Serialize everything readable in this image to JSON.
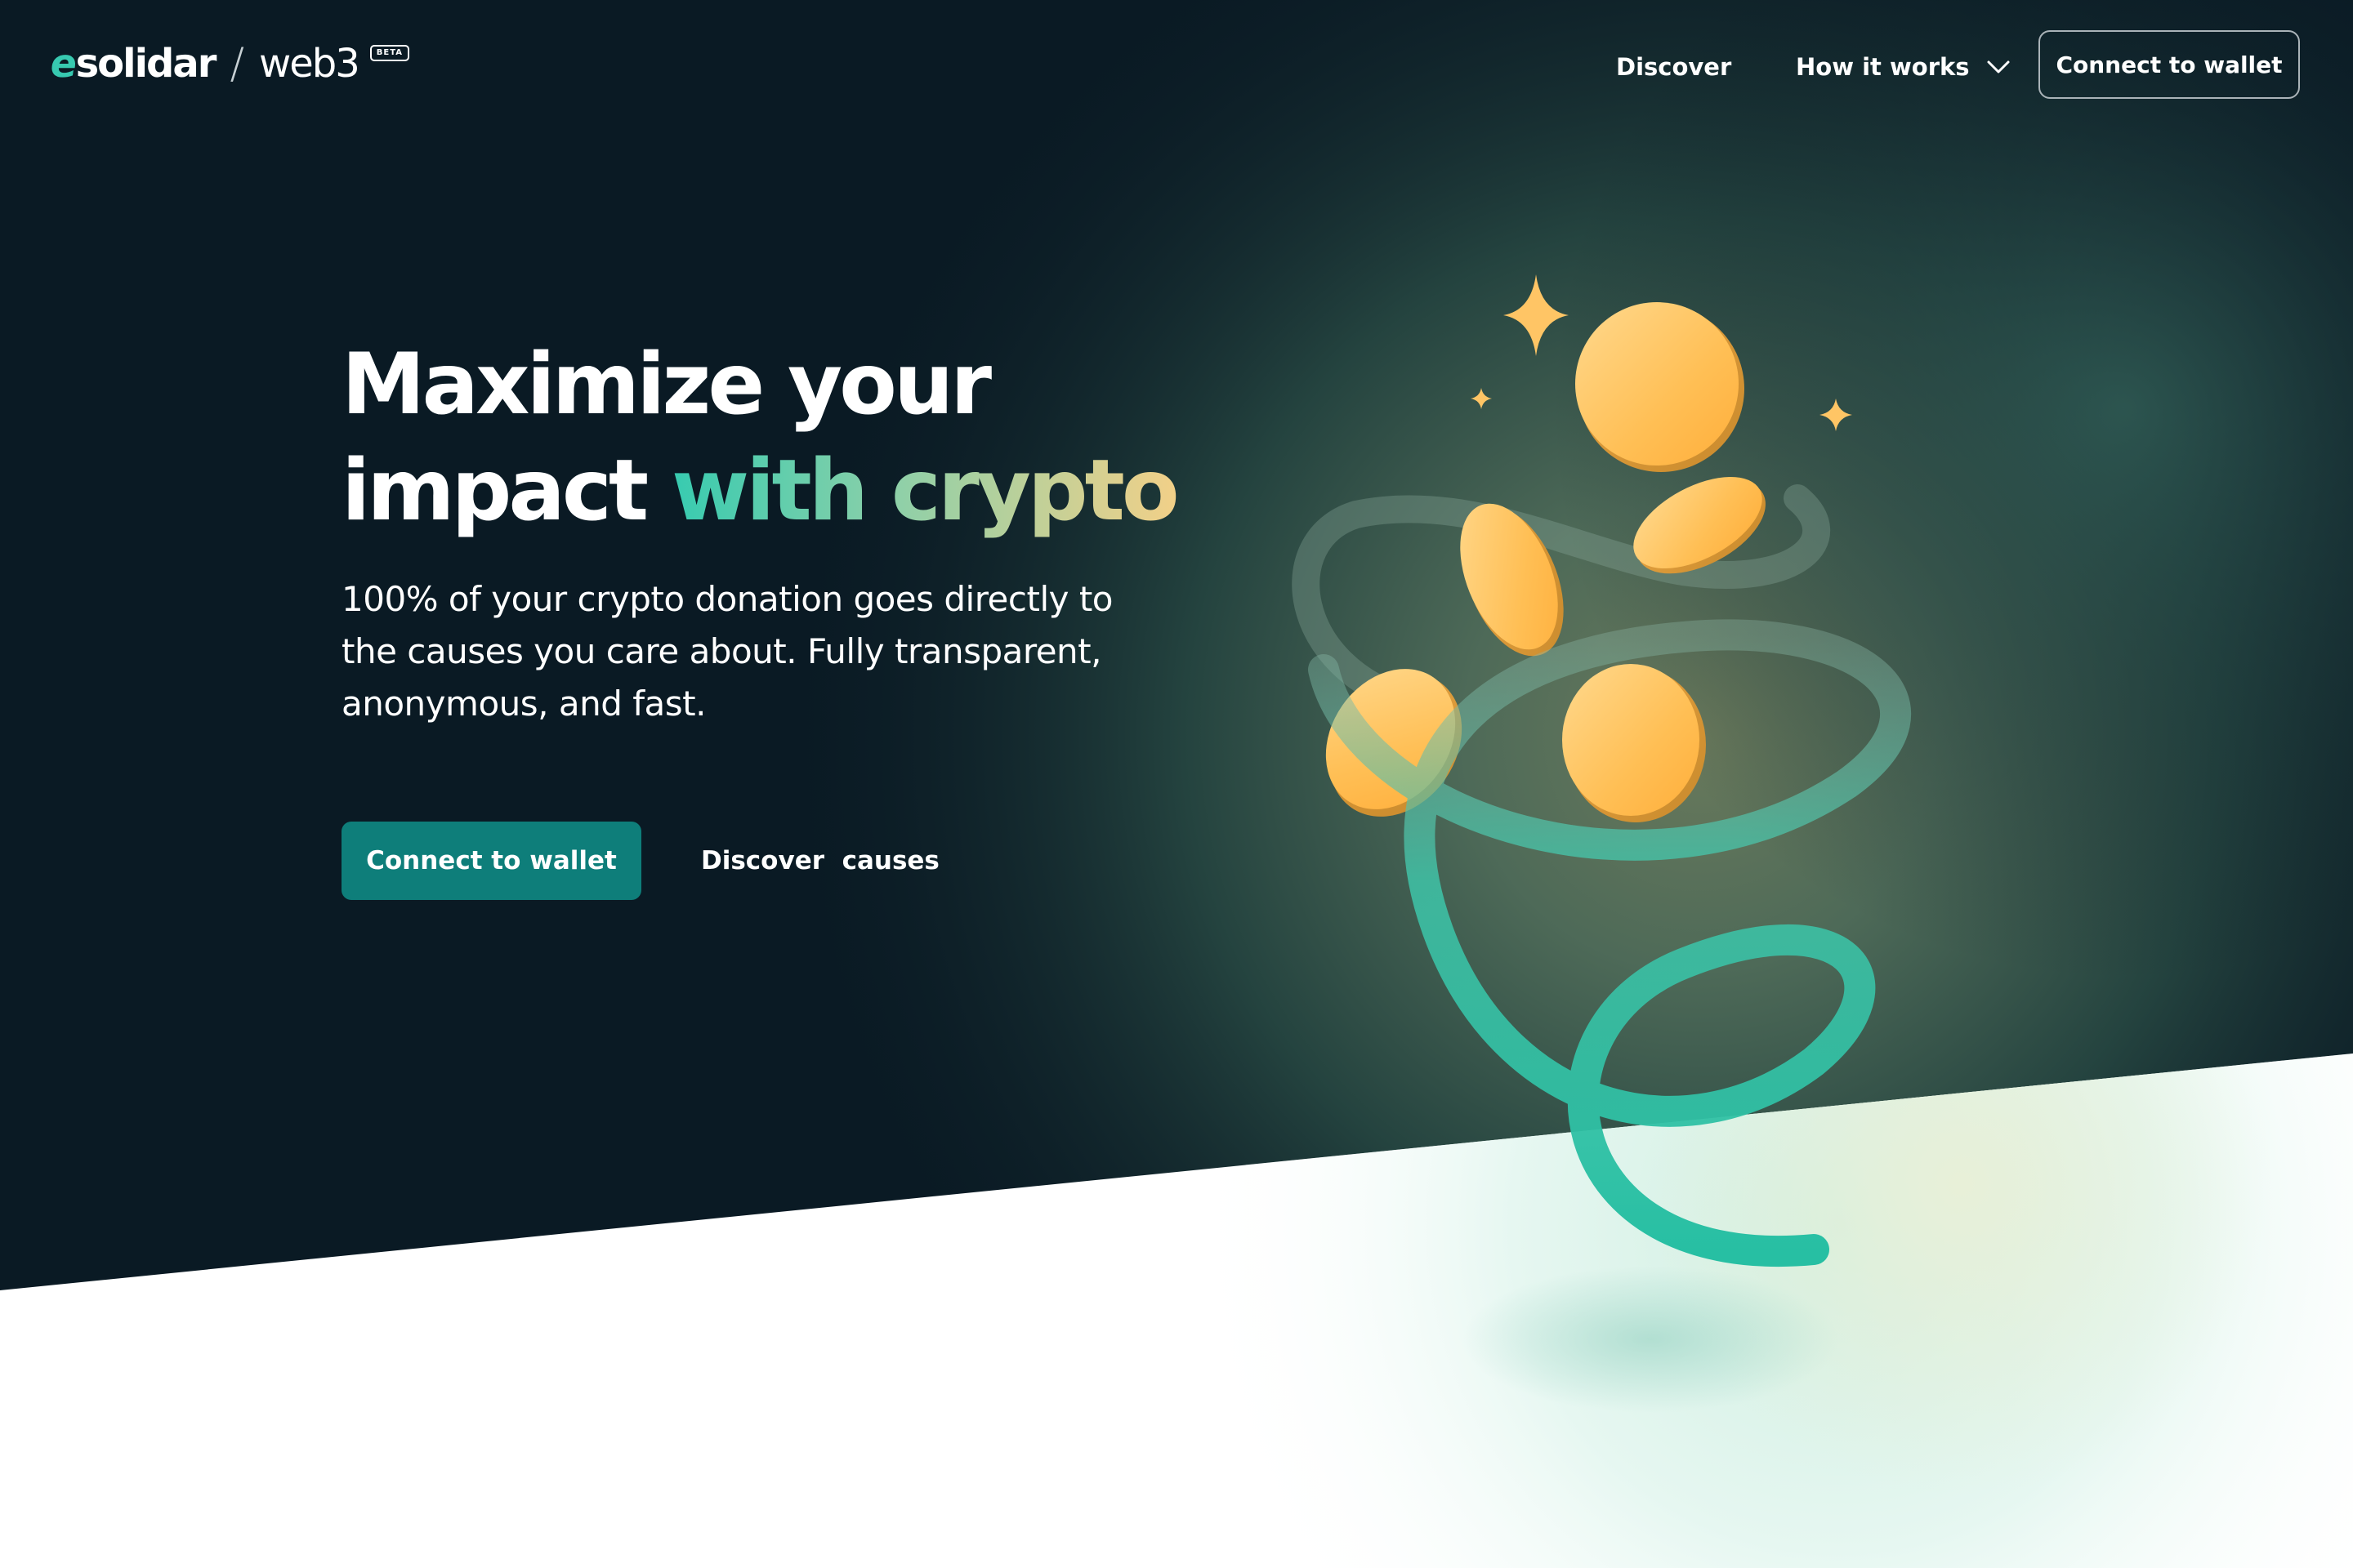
{
  "header": {
    "logo": {
      "brand": "solidar",
      "brand_mark": "e",
      "separator": "/",
      "product": "web3",
      "badge": "BETA"
    },
    "nav": {
      "discover_label": "Discover",
      "how_it_works_label": "How it works",
      "how_it_works_icon": "chevron-down-icon",
      "connect_wallet_label": "Connect to wallet"
    }
  },
  "hero": {
    "title_line1": "Maximize your",
    "title_line2_plain": "impact ",
    "title_line2_accent": "with crypto",
    "subtitle": "100% of your crypto donation goes directly to the causes you care about. Fully transparent, anonymous, and fast.",
    "primary_cta_label": "Connect to wallet",
    "secondary_cta_label": "Discover  causes"
  },
  "illustration": {
    "icons": [
      "sparkle-icon",
      "coin-icon",
      "spiral-ribbon"
    ]
  },
  "colors": {
    "navy": "#0a1a24",
    "teal": "#0e7e7a",
    "accent_teal": "#37c9b0",
    "coin_gold": "#ffb84a",
    "ribbon": "#2ebfa6"
  }
}
